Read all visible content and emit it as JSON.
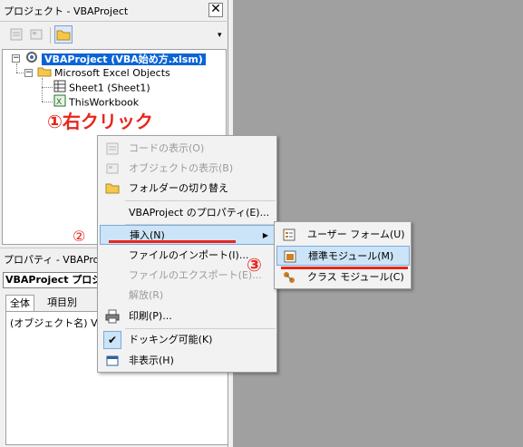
{
  "project_explorer": {
    "title": "プロジェクト - VBAProject",
    "close_glyph": "✕",
    "scroll_glyph": "▾",
    "tree": {
      "project": "VBAProject (VBA始め方.xlsm)",
      "folder": "Microsoft Excel Objects",
      "sheet1": "Sheet1 (Sheet1)",
      "workbook": "ThisWorkbook",
      "collapse_glyph": "−"
    }
  },
  "annotations": {
    "step1": "①右クリック",
    "step2": "②",
    "step3": "③",
    "color": "#e8261c"
  },
  "properties": {
    "title": "プロパティ - VBAProject",
    "selector": "VBAProject プロジ",
    "tab_all": "全体",
    "tab_category": "項目別",
    "row1": "(オブジェクト名) VBA"
  },
  "context_menu": {
    "view_code": "コードの表示(O)",
    "view_object": "オブジェクトの表示(B)",
    "toggle_folders": "フォルダーの切り替え",
    "project_properties": "VBAProject のプロパティ(E)...",
    "insert": "挿入(N)",
    "import_file": "ファイルのインポート(I)...",
    "export_file": "ファイルのエクスポート(E)...",
    "remove": "解放(R)",
    "print": "印刷(P)...",
    "dockable": "ドッキング可能(K)",
    "hide": "非表示(H)",
    "submenu_arrow": "▶",
    "check_glyph": "✔"
  },
  "submenu": {
    "userform": "ユーザー フォーム(U)",
    "module": "標準モジュール(M)",
    "class_module": "クラス モジュール(C)"
  },
  "colors": {
    "highlight": "#cce4f7",
    "selection": "#0a64d6",
    "workspace": "#a0a0a0"
  }
}
